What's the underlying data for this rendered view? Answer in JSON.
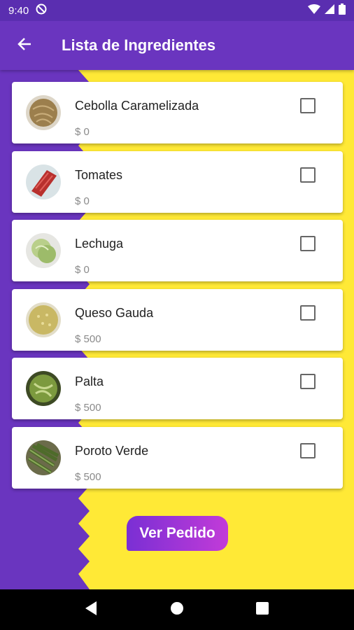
{
  "status": {
    "time": "9:40"
  },
  "appbar": {
    "title": "Lista de Ingredientes"
  },
  "colors": {
    "purple": "#6a35bf",
    "yellow": "#ffe936",
    "button_start": "#7a2fd4",
    "button_end": "#c23bd8"
  },
  "items": [
    {
      "name": "Cebolla Caramelizada",
      "price": "$ 0",
      "checked": false,
      "icon": "caramelized-onion-thumbnail"
    },
    {
      "name": "Tomates",
      "price": "$ 0",
      "checked": false,
      "icon": "tomatoes-thumbnail"
    },
    {
      "name": "Lechuga",
      "price": "$ 0",
      "checked": false,
      "icon": "lettuce-thumbnail"
    },
    {
      "name": "Queso Gauda",
      "price": "$ 500",
      "checked": false,
      "icon": "gouda-cheese-thumbnail"
    },
    {
      "name": "Palta",
      "price": "$ 500",
      "checked": false,
      "icon": "avocado-thumbnail"
    },
    {
      "name": "Poroto Verde",
      "price": "$ 500",
      "checked": false,
      "icon": "green-beans-thumbnail"
    }
  ],
  "order_button": {
    "label": "Ver Pedido"
  }
}
